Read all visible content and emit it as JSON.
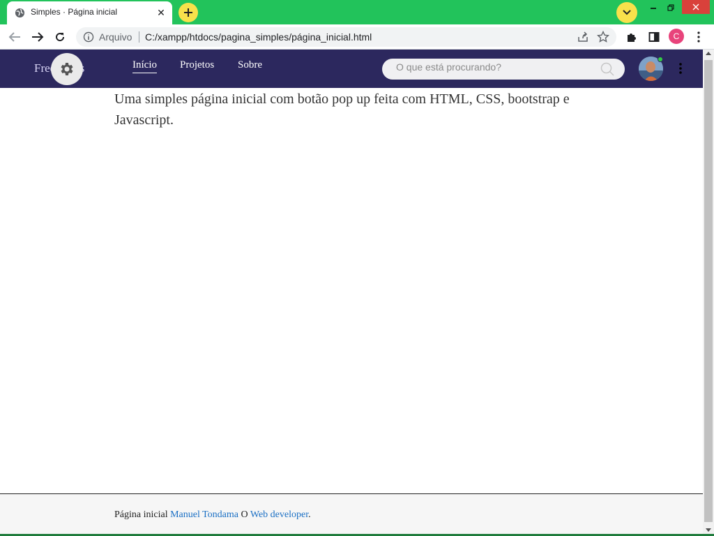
{
  "browser": {
    "tab_title": "Simples · Página inicial",
    "tab_close": "✕",
    "newtab_icon": "plus-icon",
    "omnibox_label": "Arquivo",
    "url": "C:/xampp/htdocs/pagina_simples/página_inicial.html",
    "profile_initial": "C",
    "colors": {
      "tabstrip": "#22c35b",
      "accent_yellow": "#f8e14b",
      "close_red": "#d9413b",
      "profile": "#e8437b"
    }
  },
  "site": {
    "brand": "Free grátis",
    "nav": {
      "inicio": "Início",
      "projetos": "Projetos",
      "sobre": "Sobre"
    },
    "search": {
      "placeholder": "O que está procurando?"
    },
    "colors": {
      "navbar": "#2c285e",
      "link": "#1a6fc4"
    }
  },
  "main": {
    "intro": "Uma simples página inicial com botão pop up feita com HTML, CSS, bootstrap e Javascript."
  },
  "footer": {
    "prefix": "Página inicial",
    "author": "Manuel Tondama",
    "middle": "O",
    "role": "Web developer",
    "suffix": "."
  }
}
